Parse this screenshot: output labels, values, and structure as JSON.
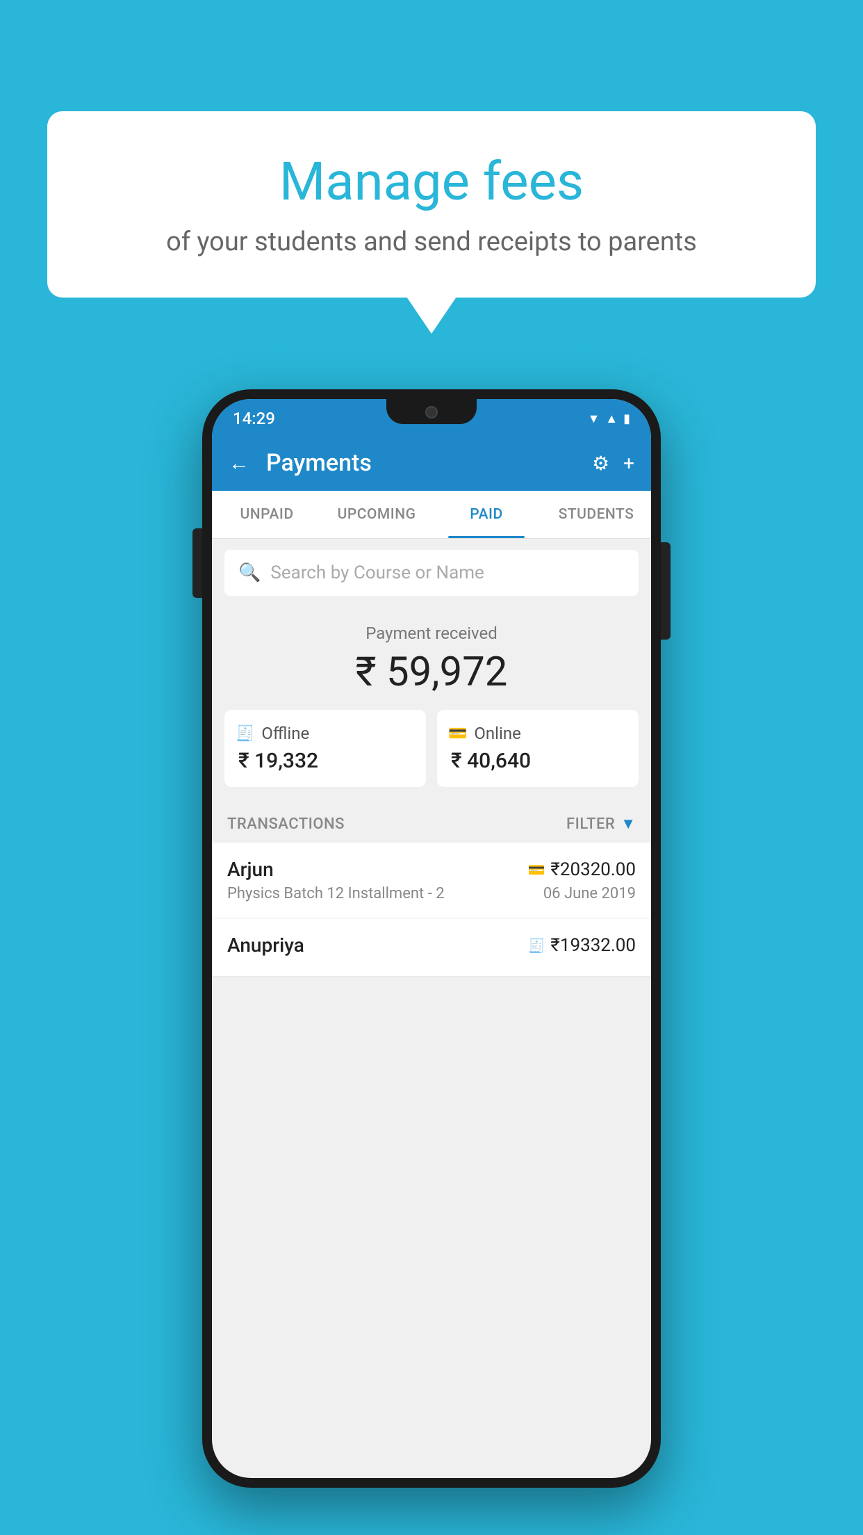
{
  "page": {
    "background_color": "#29b6d8"
  },
  "bubble": {
    "title": "Manage fees",
    "subtitle": "of your students and send receipts to parents"
  },
  "status_bar": {
    "time": "14:29",
    "icons": [
      "▼",
      "▲",
      "▮"
    ]
  },
  "header": {
    "title": "Payments",
    "back_label": "←",
    "gear_label": "⚙",
    "plus_label": "+"
  },
  "tabs": [
    {
      "id": "unpaid",
      "label": "UNPAID",
      "active": false
    },
    {
      "id": "upcoming",
      "label": "UPCOMING",
      "active": false
    },
    {
      "id": "paid",
      "label": "PAID",
      "active": true
    },
    {
      "id": "students",
      "label": "STUDENTS",
      "active": false
    }
  ],
  "search": {
    "placeholder": "Search by Course or Name"
  },
  "payment_summary": {
    "label": "Payment received",
    "total": "₹ 59,972",
    "offline": {
      "label": "Offline",
      "amount": "₹ 19,332"
    },
    "online": {
      "label": "Online",
      "amount": "₹ 40,640"
    }
  },
  "transactions": {
    "header_label": "TRANSACTIONS",
    "filter_label": "FILTER",
    "items": [
      {
        "name": "Arjun",
        "course": "Physics Batch 12 Installment - 2",
        "amount": "₹20320.00",
        "date": "06 June 2019",
        "type": "online"
      },
      {
        "name": "Anupriya",
        "course": "",
        "amount": "₹19332.00",
        "date": "",
        "type": "offline"
      }
    ]
  }
}
